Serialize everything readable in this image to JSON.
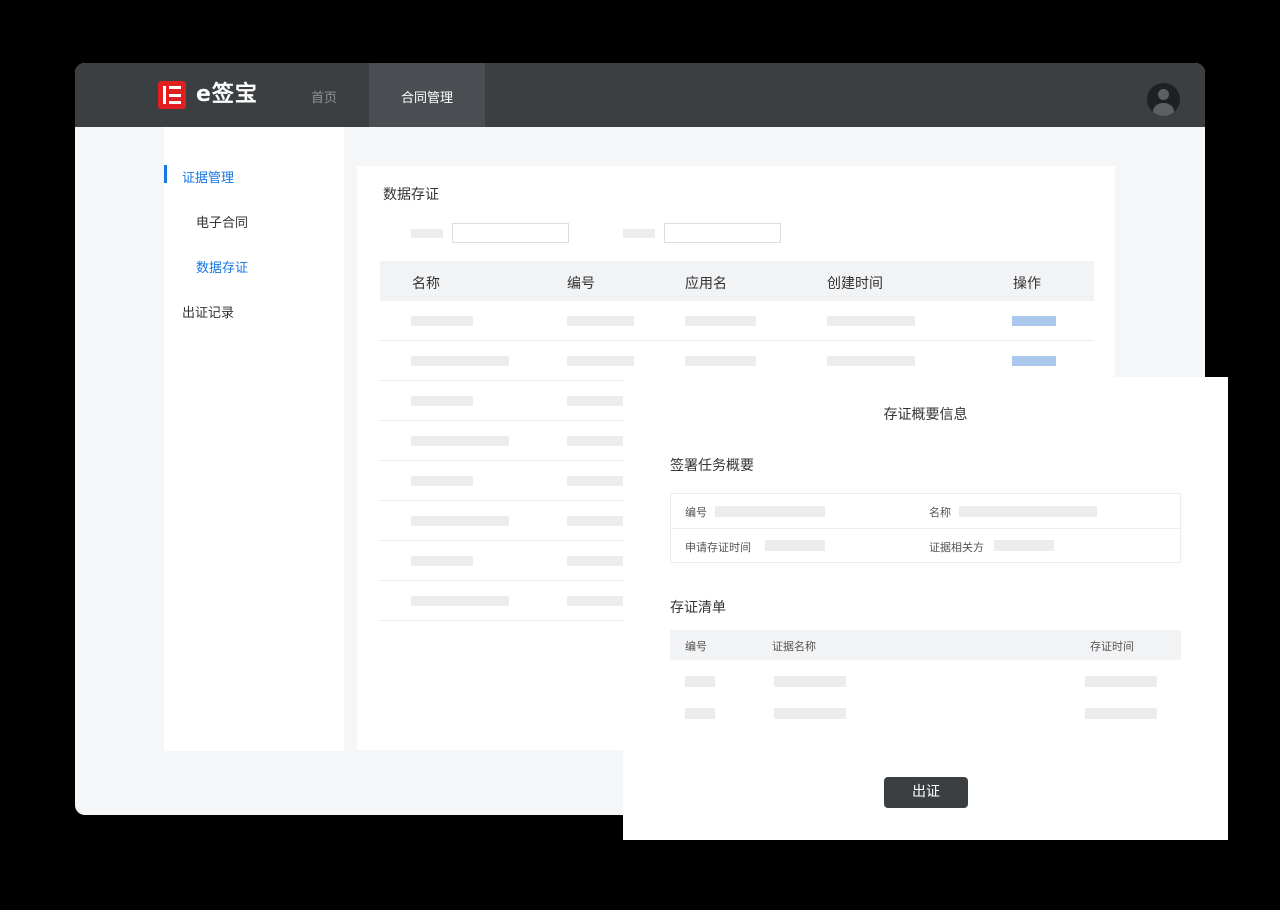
{
  "brand": {
    "name": "e签宝",
    "color": "#e02020"
  },
  "nav": {
    "home": "首页",
    "contract_management": "合同管理"
  },
  "sidebar": {
    "items": [
      {
        "label": "证据管理",
        "active": true
      },
      {
        "label": "电子合同"
      },
      {
        "label": "数据存证",
        "selected": true
      },
      {
        "label": "出证记录"
      }
    ]
  },
  "content": {
    "title": "数据存证",
    "table": {
      "columns": [
        "名称",
        "编号",
        "应用名",
        "创建时间",
        "操作"
      ]
    }
  },
  "modal": {
    "title": "存证概要信息",
    "summary_section": "签署任务概要",
    "summary_fields": {
      "number": "编号",
      "name": "名称",
      "apply_time": "申请存证时间",
      "related_party": "证据相关方"
    },
    "list_section": "存证清单",
    "list_columns": [
      "编号",
      "证据名称",
      "存证时间"
    ],
    "issue_button": "出证"
  },
  "colors": {
    "accent": "#1677e5",
    "topbar": "#3c3f42",
    "button": "#3c3f42"
  }
}
